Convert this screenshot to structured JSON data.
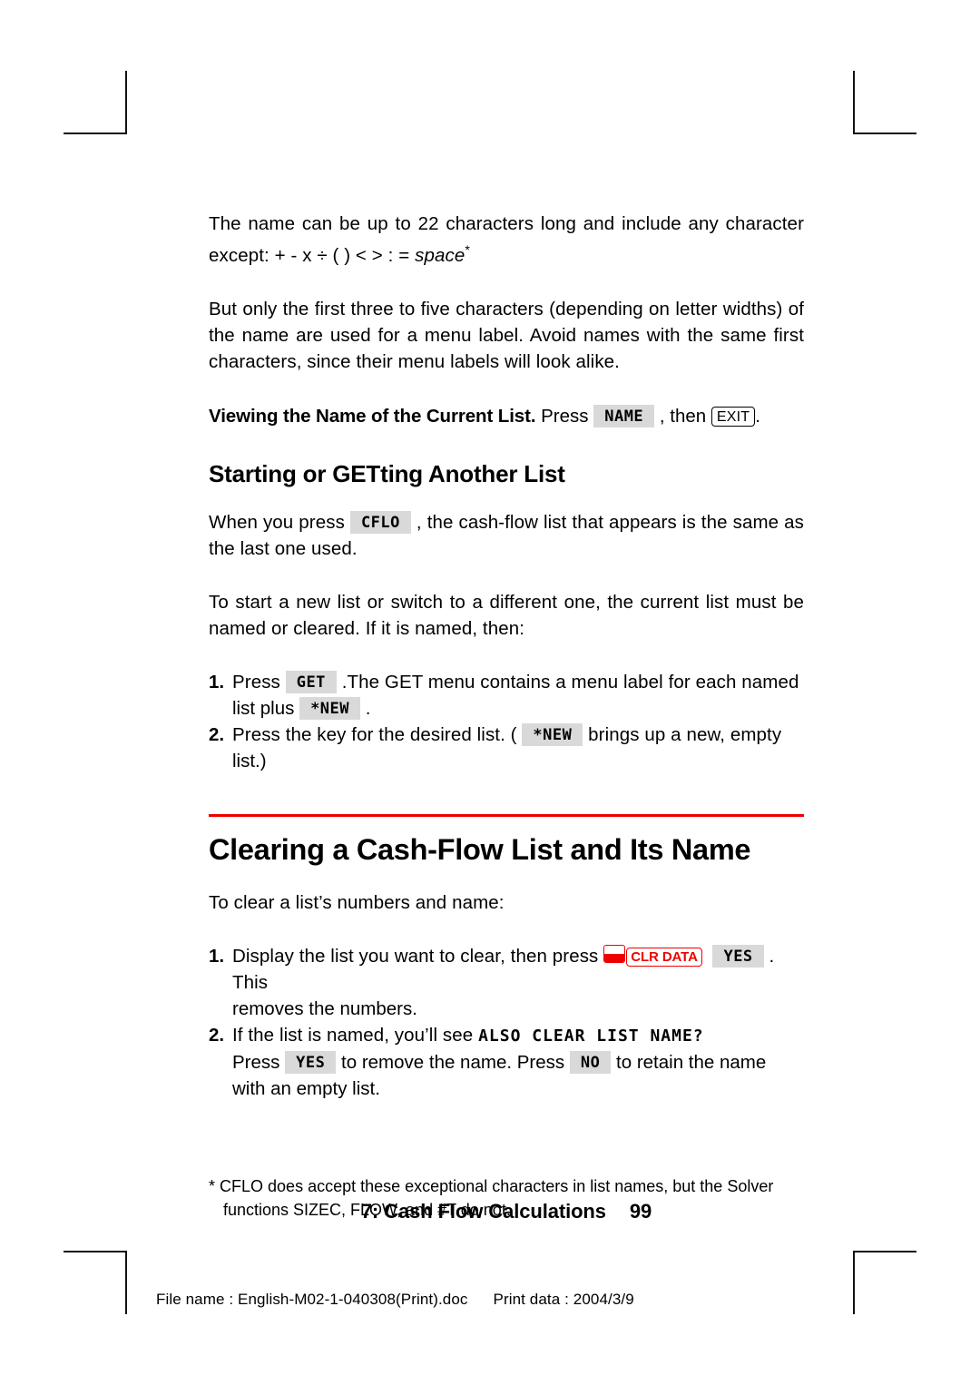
{
  "document": {
    "type": "printed-manual-page",
    "page_number": "99",
    "running_footer": "7: Cash Flow Calculations",
    "print_slug": {
      "file_label": "File name :",
      "file_value": "English-M02-1-040308(Print).doc",
      "date_label": "Print data :",
      "date_value": "2004/3/9"
    },
    "accent_color": "#ee0000",
    "softkey_bg": "#d9d9d9"
  },
  "body": {
    "para1_a": "The name can be up to 22 characters long and include any character except: + ",
    "para1_ops": "-  x ÷ ( ) < > : = ",
    "para1_space": "space",
    "para1_star": "*",
    "para2": "But only the first three to five characters (depending on letter widths) of the name are used for a menu label. Avoid names with the same first characters, since their menu labels will look alike.",
    "runin": {
      "bold_lead": "Viewing the Name of the Current List.",
      "press": " Press ",
      "key_name": "NAME",
      "then": " , then ",
      "key_exit": "EXIT",
      "period": "."
    }
  },
  "section_getting": {
    "heading": "Starting or GETting Another List",
    "intro_a": "When you press ",
    "intro_key": "CFLO",
    "intro_b": " , the cash-flow list that appears is the same as the last one used.",
    "para": "To start a new list or switch to a different one, the current list must be named or cleared. If it is named, then:",
    "steps": [
      {
        "num": "1.",
        "text_a": "Press ",
        "key": "GET",
        "text_b": " .The GET menu contains a menu label for each named",
        "cont_a": "list plus ",
        "cont_key": "*NEW",
        "cont_b": " ."
      },
      {
        "num": "2.",
        "text_a": "Press the key for the desired list. ( ",
        "key": "*NEW",
        "text_b": " brings up a new, empty",
        "cont_a": "list.)"
      }
    ]
  },
  "section_clearing": {
    "heading": "Clearing a Cash-Flow List and Its Name",
    "intro": "To clear a list’s numbers and name:",
    "steps": [
      {
        "num": "1.",
        "text_a": "Display the list you want to clear, then press ",
        "shift_icon": "shift-key-icon",
        "key_clrdata": "CLR DATA",
        "key_yes": "YES",
        "text_b": " . This",
        "cont_a": "removes the numbers."
      },
      {
        "num": "2.",
        "text_a": "If the list is named, you’ll see ",
        "lcd_message": "ALSO CLEAR LIST NAME?",
        "cont_a": "Press ",
        "cont_key_yes": "YES",
        "cont_b": " to remove the name. Press ",
        "cont_key_no": "NO",
        "cont_c": " to retain the name",
        "cont_d": "with an empty list."
      }
    ]
  },
  "footnote": {
    "marker": "*",
    "text": "CFLO does accept these exceptional characters in list names, but the Solver functions SIZEC, FLOW, and #T do not."
  }
}
